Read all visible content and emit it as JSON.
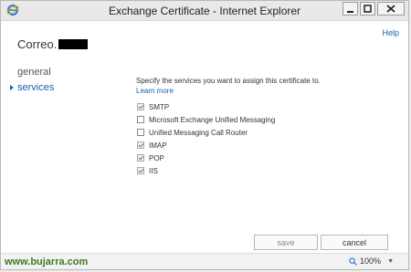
{
  "window": {
    "title": "Exchange Certificate - Internet Explorer"
  },
  "header": {
    "help": "Help",
    "name_prefix": "Correo."
  },
  "nav": {
    "items": [
      {
        "label": "general"
      },
      {
        "label": "services"
      }
    ]
  },
  "main": {
    "description": "Specify the services you want to assign this certificate to.",
    "learn_more": "Learn more",
    "services": [
      {
        "label": "SMTP",
        "checked": true
      },
      {
        "label": "Microsoft Exchange Unified Messaging",
        "checked": false
      },
      {
        "label": "Unified Messaging Call Router",
        "checked": false
      },
      {
        "label": "IMAP",
        "checked": true
      },
      {
        "label": "POP",
        "checked": true
      },
      {
        "label": "IIS",
        "checked": true
      }
    ]
  },
  "footer": {
    "save": "save",
    "cancel": "cancel"
  },
  "status": {
    "watermark": "www.bujarra.com",
    "zoom": "100%"
  }
}
